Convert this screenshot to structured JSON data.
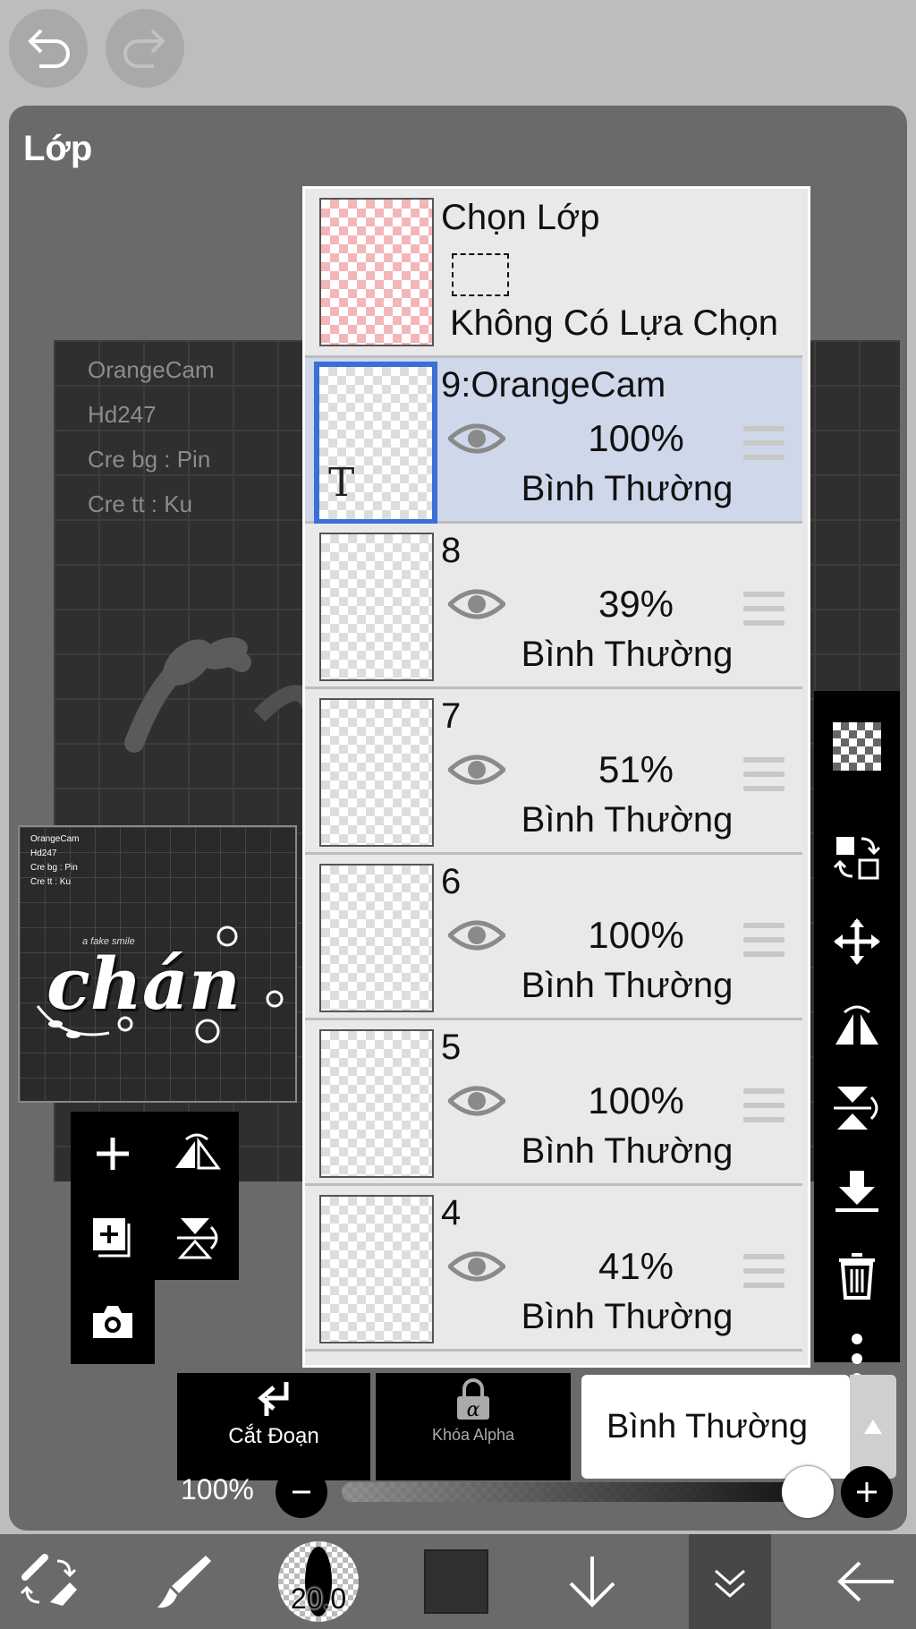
{
  "panel": {
    "title": "Lớp"
  },
  "canvas_credits": [
    "OrangeCam",
    "Hd247",
    "Cre bg : Pin",
    "Cre tt : Ku"
  ],
  "thumbnail": {
    "credits": [
      "OrangeCam",
      "Hd247",
      "Cre bg : Pin",
      "Cre tt : Ku"
    ],
    "artwork_text": "chán",
    "artwork_subtext": "a fake smile"
  },
  "selection_layer": {
    "title": "Chọn Lớp",
    "status": "Không Có Lựa Chọn"
  },
  "layers": [
    {
      "name": "9:OrangeCam",
      "opacity": "100%",
      "blend": "Bình Thường",
      "selected": true,
      "text_icon": "T"
    },
    {
      "name": "8",
      "opacity": "39%",
      "blend": "Bình Thường",
      "selected": false
    },
    {
      "name": "7",
      "opacity": "51%",
      "blend": "Bình Thường",
      "selected": false
    },
    {
      "name": "6",
      "opacity": "100%",
      "blend": "Bình Thường",
      "selected": false
    },
    {
      "name": "5",
      "opacity": "100%",
      "blend": "Bình Thường",
      "selected": false
    },
    {
      "name": "4",
      "opacity": "41%",
      "blend": "Bình Thường",
      "selected": false
    }
  ],
  "bottom_actions": {
    "clip_label": "Cắt Đoạn",
    "alpha_lock_label": "Khóa Alpha",
    "blend_mode": "Bình Thường"
  },
  "opacity_slider": {
    "label": "100%",
    "value": 1.0
  },
  "toolbar": {
    "brush_size": "20.0"
  },
  "colors": {
    "selected_border": "#3a6fd6",
    "selected_row": "#cfd8ea",
    "panel_bg": "#6a6a6a"
  }
}
